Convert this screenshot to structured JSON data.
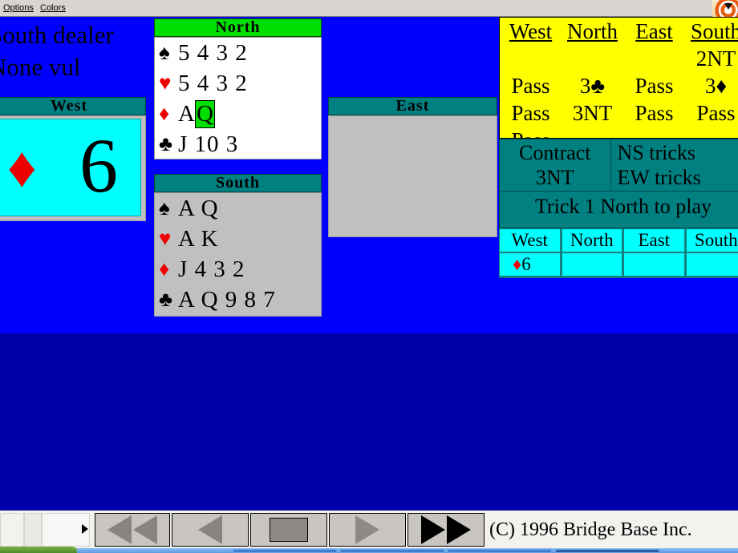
{
  "menu": {
    "items": [
      {
        "label": "Options",
        "accel": "O"
      },
      {
        "label": "Colors",
        "accel": "C"
      }
    ]
  },
  "deal_info": {
    "dealer_line": "South dealer",
    "vulnerability_line": "None vul"
  },
  "hands": {
    "north": {
      "title": "North",
      "suits": [
        {
          "symbol": "♠",
          "name": "spade-symbol",
          "color": "black",
          "cards": "5 4 3 2"
        },
        {
          "symbol": "♥",
          "name": "heart-symbol",
          "color": "red",
          "cards": "5 4 3 2"
        },
        {
          "symbol": "♦",
          "name": "diamond-symbol",
          "color": "red",
          "cards": "A",
          "highlight_card": "Q"
        },
        {
          "symbol": "♣",
          "name": "club-symbol",
          "color": "black",
          "cards": "J 10 3"
        }
      ]
    },
    "south": {
      "title": "South",
      "suits": [
        {
          "symbol": "♠",
          "name": "spade-symbol",
          "color": "black",
          "cards": "A Q"
        },
        {
          "symbol": "♥",
          "name": "heart-symbol",
          "color": "red",
          "cards": "A K"
        },
        {
          "symbol": "♦",
          "name": "diamond-symbol",
          "color": "red",
          "cards": "J 4 3 2"
        },
        {
          "symbol": "♣",
          "name": "club-symbol",
          "color": "black",
          "cards": "A Q 9 8 7"
        }
      ]
    },
    "west": {
      "title": "West",
      "played_card": {
        "suit_symbol": "♦",
        "suit_color": "red",
        "rank": "6"
      }
    },
    "east": {
      "title": "East",
      "cards_hidden": true
    }
  },
  "auction": {
    "headers": [
      "West",
      "North",
      "East",
      "South"
    ],
    "rows": [
      [
        "",
        "",
        "",
        "2NT"
      ],
      [
        "Pass",
        "3♣",
        "Pass",
        "3♦"
      ],
      [
        "Pass",
        "3NT",
        "Pass",
        "Pass"
      ],
      [
        "Pass",
        "",
        "",
        ""
      ]
    ]
  },
  "info": {
    "contract_label": "Contract",
    "contract_value": "3NT",
    "ns_tricks_label": "NS tricks",
    "ns_tricks_value": "",
    "ew_tricks_label": "EW tricks",
    "ew_tricks_value": "",
    "trick_status": "Trick 1 North to play"
  },
  "current_trick": {
    "headers": [
      "West",
      "North",
      "East",
      "South"
    ],
    "plays": [
      {
        "suit_symbol": "♦",
        "suit_color": "red",
        "rank": "6"
      },
      {
        "suit_symbol": "",
        "suit_color": "black",
        "rank": ""
      },
      {
        "suit_symbol": "",
        "suit_color": "black",
        "rank": ""
      },
      {
        "suit_symbol": "",
        "suit_color": "black",
        "rank": ""
      }
    ]
  },
  "toolbar": {
    "buttons": [
      {
        "name": "first-deal-button",
        "glyph": "double-left-triangle"
      },
      {
        "name": "previous-deal-button",
        "glyph": "left-triangle"
      },
      {
        "name": "stop-button",
        "glyph": "square"
      },
      {
        "name": "next-trick-button",
        "glyph": "right-triangle-outline"
      },
      {
        "name": "play-forward-button",
        "glyph": "double-right-triangle"
      }
    ],
    "copyright": "(C) 1996 Bridge Base Inc."
  },
  "colors": {
    "table_blue": "#0000ff",
    "table_blue_dark": "#0000aa",
    "auction_yellow": "#ffff00",
    "panel_teal": "#008080",
    "north_green": "#00e000",
    "card_cyan": "#00ffff",
    "suit_red": "#ee0000",
    "panel_gray": "#c0c0c0"
  }
}
